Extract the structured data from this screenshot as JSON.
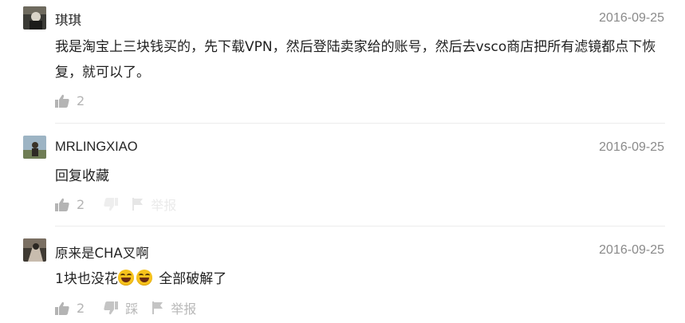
{
  "comments": [
    {
      "name": "琪琪",
      "date": "2016-09-25",
      "text": "我是淘宝上三块钱买的，先下载VPN，然后登陆卖家给的账号，然后去vsco商店把所有滤镜都点下恢复，就可以了。",
      "likes": "2",
      "avatar_icon": "user-avatar"
    },
    {
      "name": "MRLINGXIAO",
      "date": "2016-09-25",
      "text": "回复收藏",
      "likes": "2",
      "report_label": "举报",
      "avatar_icon": "user-avatar"
    },
    {
      "name": "原来是CHA叉啊",
      "date": "2016-09-25",
      "text_before": "1块也没花",
      "text_after": " 全部破解了",
      "emojis": [
        "grinning-face-emoji",
        "grinning-face-emoji"
      ],
      "likes": "2",
      "dislike_label": "踩",
      "report_label": "举报",
      "avatar_icon": "user-avatar"
    }
  ],
  "colors": {
    "meta_gray": "#8a8a8a",
    "action_gray": "#b4b4b4",
    "divider": "#ececec"
  }
}
